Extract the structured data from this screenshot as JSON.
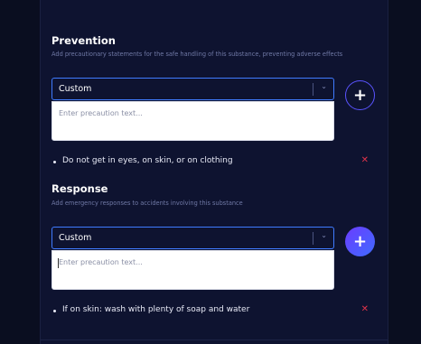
{
  "prevention": {
    "title": "Prevention",
    "description": "Add precautionary statements for the safe handling of this substance, preventing adverse effects",
    "select_value": "Custom",
    "textarea_placeholder": "Enter precaution text...",
    "items": [
      {
        "text": "Do not get in eyes, on skin, or on clothing"
      }
    ]
  },
  "response": {
    "title": "Response",
    "description": "Add emergency responses to accidents involving this substance",
    "select_value": "Custom",
    "textarea_placeholder": "Enter precaution text...",
    "items": [
      {
        "text": "If on skin: wash with plenty of soap and water"
      }
    ]
  },
  "icons": {
    "add": "plus-icon",
    "remove": "close-icon",
    "dropdown": "chevron-down-icon"
  },
  "colors": {
    "background": "#0c1026",
    "accent_blue": "#3f7bff",
    "accent_purple": "#6b3cff",
    "remove_red": "#e0334a"
  }
}
